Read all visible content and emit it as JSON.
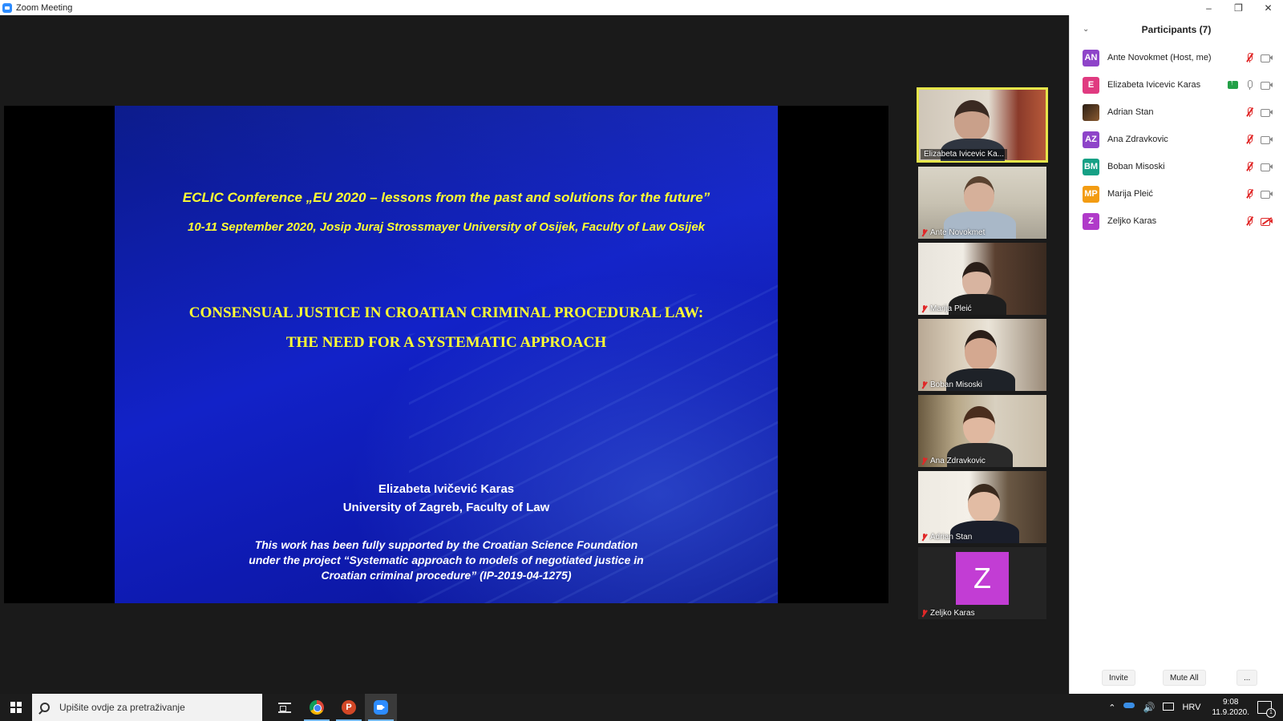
{
  "window": {
    "title": "Zoom Meeting",
    "controls": {
      "minimize": "–",
      "restore": "❐",
      "close": "✕"
    }
  },
  "slide": {
    "conference_title": "ECLIC Conference „EU 2020 – lessons from the past and solutions for the future”",
    "conference_date": "10-11 September 2020, Josip Juraj Strossmayer University of Osijek, Faculty of Law Osijek",
    "paper_title_line1": "CONSENSUAL JUSTICE IN CROATIAN CRIMINAL PROCEDURAL LAW:",
    "paper_title_line2": "THE NEED FOR A SYSTEMATIC APPROACH",
    "author": "Elizabeta Ivičević Karas",
    "affiliation": "University of Zagreb, Faculty of Law",
    "support_line1": "This work has been fully supported by the Croatian Science Foundation",
    "support_line2": "under the project “Systematic approach to models of negotiated justice in",
    "support_line3": "Croatian criminal procedure” (IP-2019-04-1275)"
  },
  "video_tiles": [
    {
      "name": "Elizabeta Ivicevic Ka...",
      "muted": false,
      "active": true
    },
    {
      "name": "Ante Novokmet",
      "muted": true
    },
    {
      "name": "Marija Pleić",
      "muted": true
    },
    {
      "name": "Boban Misoski",
      "muted": true
    },
    {
      "name": "Ana Zdravkovic",
      "muted": true
    },
    {
      "name": "Adrian Stan",
      "muted": true
    },
    {
      "name": "Zeljko Karas",
      "muted": true,
      "avatar_letter": "Z"
    }
  ],
  "participants": {
    "title": "Participants (7)",
    "list": [
      {
        "initials": "AN",
        "name": "Ante Novokmet (Host, me)",
        "color": "#8e44c9"
      },
      {
        "initials": "E",
        "name": "Elizabeta Ivicevic Karas",
        "color": "#e03a80"
      },
      {
        "initials": "",
        "name": "Adrian Stan",
        "color": "#5a3a1e"
      },
      {
        "initials": "AZ",
        "name": "Ana Zdravkovic",
        "color": "#8e44c9"
      },
      {
        "initials": "BM",
        "name": "Boban Misoski",
        "color": "#16a085"
      },
      {
        "initials": "MP",
        "name": "Marija Pleić",
        "color": "#f39c12"
      },
      {
        "initials": "Z",
        "name": "Zeljko Karas",
        "color": "#b03ac9"
      }
    ],
    "buttons": {
      "invite": "Invite",
      "mute_all": "Mute All",
      "more": "..."
    }
  },
  "taskbar": {
    "search_placeholder": "Upišite ovdje za pretraživanje",
    "ppt_letter": "P",
    "language": "HRV",
    "time": "9:08",
    "date": "11.9.2020."
  }
}
